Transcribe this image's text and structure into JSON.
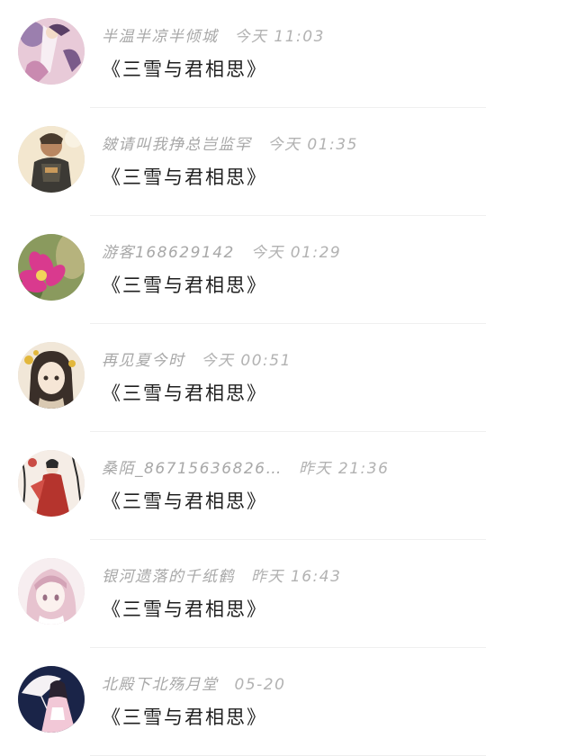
{
  "comments": [
    {
      "user": "半温半凉半倾城",
      "time": "今天 11:03",
      "text": "《三雪与君相思》",
      "avatar_icon": "fantasy-dancer-avatar-icon",
      "avatar_colors": [
        "#d9a8c6",
        "#7a5b8a",
        "#f3e2ea"
      ]
    },
    {
      "user": "皴请叫我挣总岂监罕",
      "time": "今天 01:35",
      "text": "《三雪与君相思》",
      "avatar_icon": "game-soldier-avatar-icon",
      "avatar_colors": [
        "#f0e2c4",
        "#3c3a35",
        "#c99a5b"
      ]
    },
    {
      "user": "游客168629142",
      "time": "今天 01:29",
      "text": "《三雪与君相思》",
      "avatar_icon": "cactus-flower-avatar-icon",
      "avatar_colors": [
        "#5e7340",
        "#d93a8e",
        "#b6b37d"
      ]
    },
    {
      "user": "再见夏今时",
      "time": "今天 00:51",
      "text": "《三雪与君相思》",
      "avatar_icon": "anime-girl-avatar-icon",
      "avatar_colors": [
        "#f1e7d8",
        "#3a2f29",
        "#e2b73c"
      ]
    },
    {
      "user": "桑陌_86715636826…",
      "time": "昨天 21:36",
      "text": "《三雪与君相思》",
      "avatar_icon": "red-robe-figure-avatar-icon",
      "avatar_colors": [
        "#f5ede6",
        "#b5342d",
        "#2b2b2b"
      ]
    },
    {
      "user": "银河遗落的千纸鹤",
      "time": "昨天 16:43",
      "text": "《三雪与君相思》",
      "avatar_icon": "pink-anime-girl-avatar-icon",
      "avatar_colors": [
        "#f2dfe4",
        "#d3a3b6",
        "#ffffff"
      ]
    },
    {
      "user": "北殿下北殇月堂",
      "time": "05-20",
      "text": "《三雪与君相思》",
      "avatar_icon": "umbrella-girl-avatar-icon",
      "avatar_colors": [
        "#1a2448",
        "#f2c8d7",
        "#ffffff"
      ]
    }
  ]
}
